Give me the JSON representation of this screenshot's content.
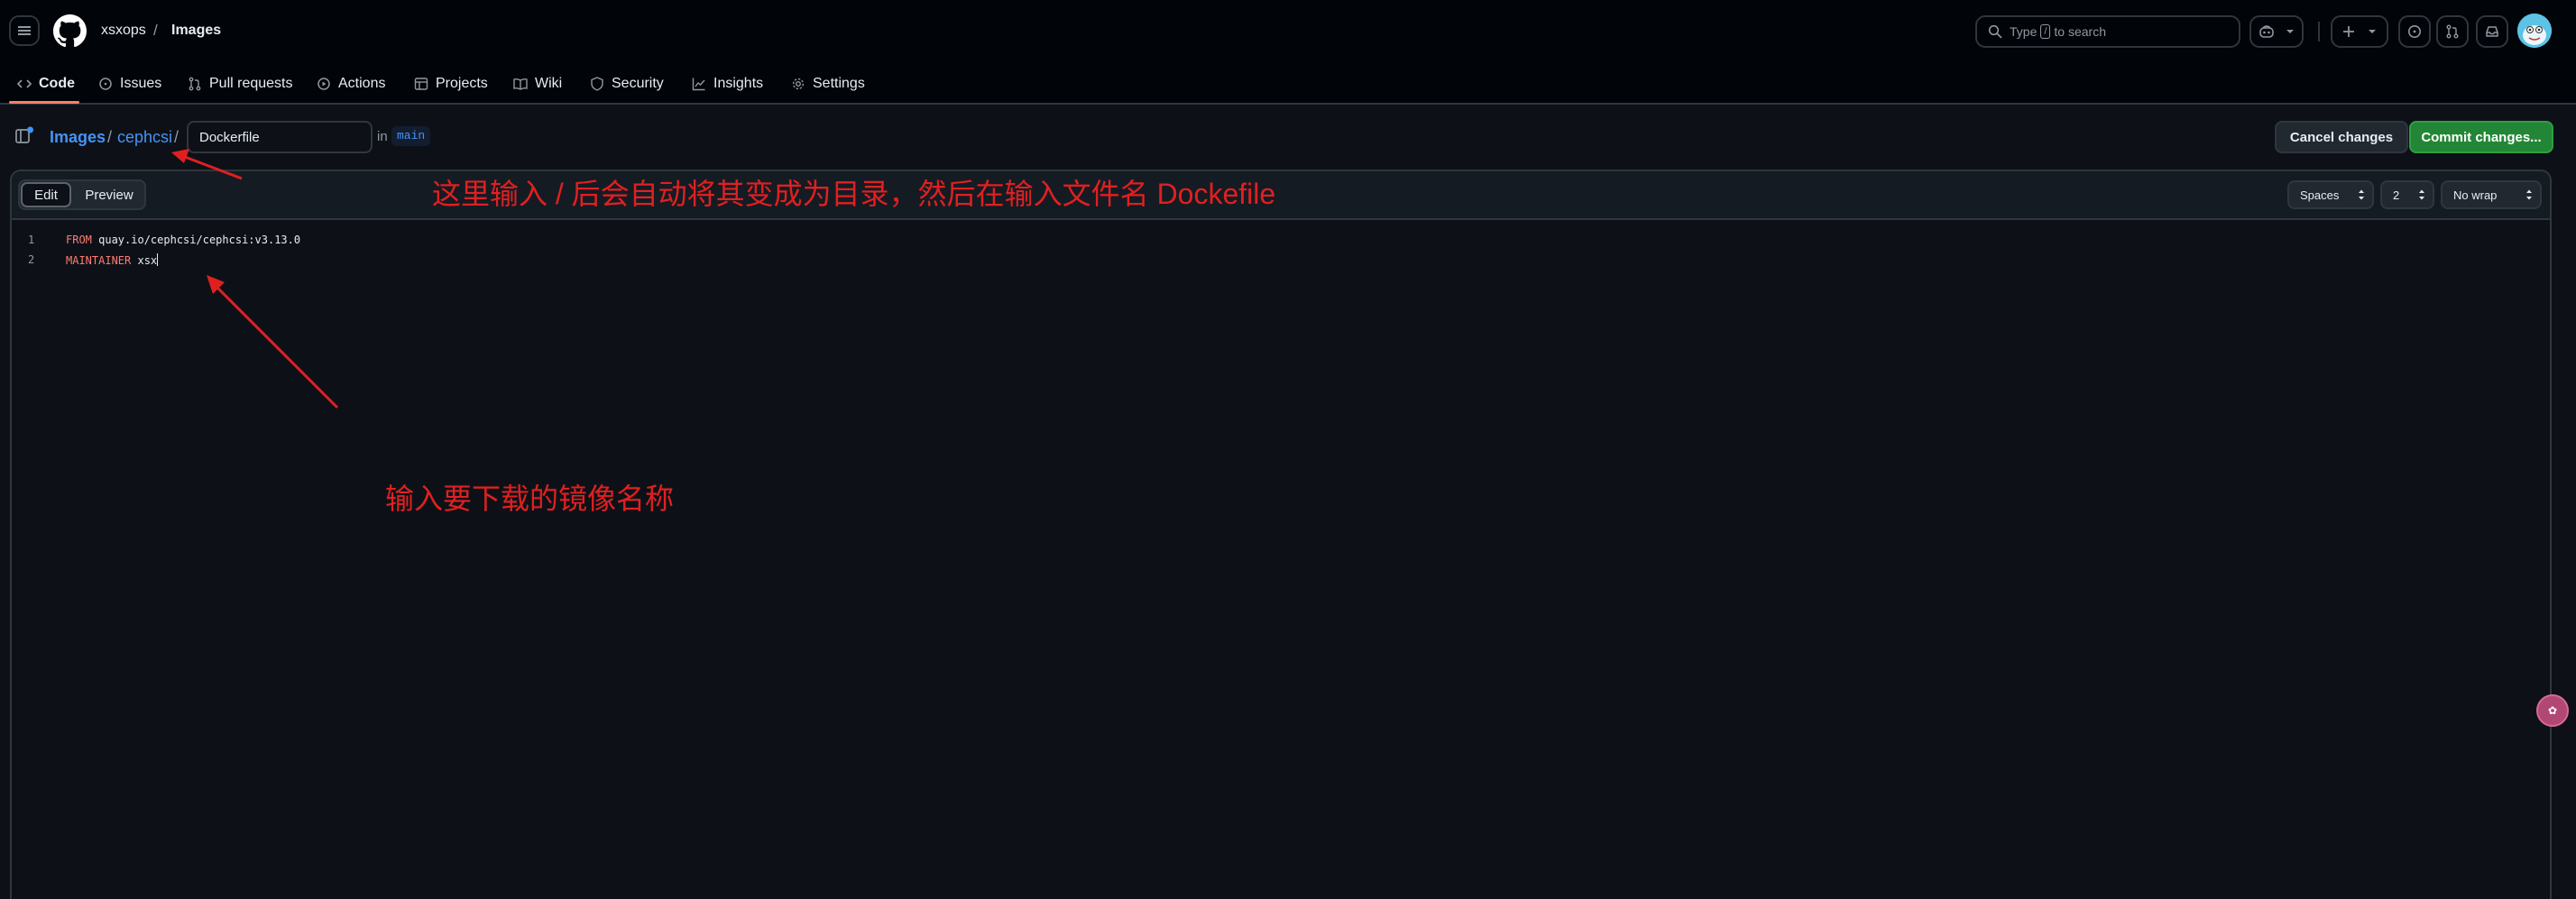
{
  "header": {
    "owner": "xsxops",
    "separator": "/",
    "repo": "Images",
    "search": {
      "prefix": "Type",
      "key": "/",
      "suffix": "to search"
    },
    "icons": {
      "menu": "hamburger-icon",
      "logo": "github-logo",
      "copilot": "copilot-icon",
      "create": "plus-icon",
      "issues": "issue-opened-icon",
      "pulls": "git-pull-request-icon",
      "inbox": "inbox-icon",
      "avatar": "user-avatar"
    }
  },
  "repo_nav": {
    "items": [
      {
        "label": "Code",
        "icon": "code-icon",
        "active": true
      },
      {
        "label": "Issues",
        "icon": "issue-opened-icon"
      },
      {
        "label": "Pull requests",
        "icon": "git-pull-request-icon"
      },
      {
        "label": "Actions",
        "icon": "play-icon"
      },
      {
        "label": "Projects",
        "icon": "table-icon"
      },
      {
        "label": "Wiki",
        "icon": "book-icon"
      },
      {
        "label": "Security",
        "icon": "shield-icon"
      },
      {
        "label": "Insights",
        "icon": "graph-icon"
      },
      {
        "label": "Settings",
        "icon": "gear-icon"
      }
    ]
  },
  "path_bar": {
    "repo_link": "Images",
    "slash": "/",
    "dir_link": "cephcsi",
    "filename_value": "Dockerfile",
    "in_label": "in",
    "branch": "main",
    "cancel_label": "Cancel changes",
    "commit_label": "Commit changes..."
  },
  "editor": {
    "tabs": {
      "edit": "Edit",
      "preview": "Preview",
      "selected": "Edit"
    },
    "indent_mode": "Spaces",
    "indent_size": "2",
    "wrap_mode": "No wrap",
    "lines": [
      {
        "number": "1",
        "keyword": "FROM",
        "text": " quay.io/cephcsi/cephcsi:v3.13.0"
      },
      {
        "number": "2",
        "keyword": "MAINTAINER",
        "text": " xsx"
      }
    ]
  },
  "annotations": {
    "top_note": "这里输入 / 后会自动将其变成为目录，然后在输入文件名 Dockefile",
    "bottom_note": "输入要下载的镜像名称",
    "color": "#e02020"
  },
  "colors": {
    "page_bg": "#0d1117",
    "header_bg": "#010409",
    "border": "#30363d",
    "link": "#4493f8",
    "accent_underline": "#f78166",
    "primary_button": "#238636",
    "keyword": "#ff7b72"
  }
}
